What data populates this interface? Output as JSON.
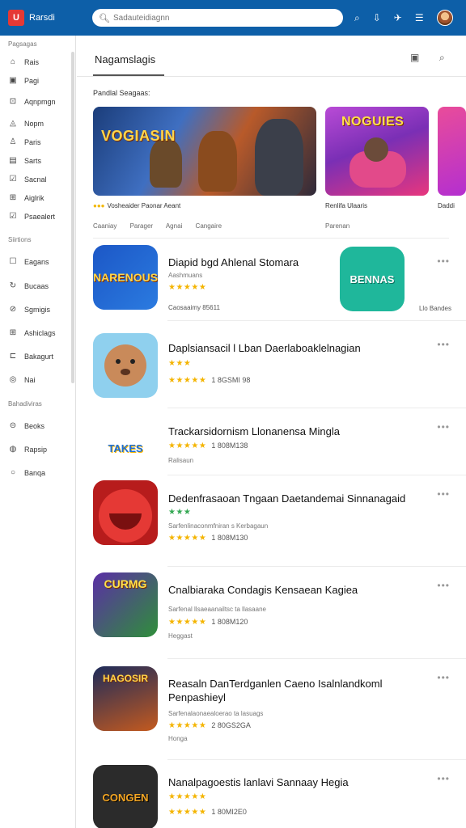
{
  "topbar": {
    "logo_glyph": "U",
    "brand": "Rarsdi",
    "search_placeholder": "Sadauteidiagnn",
    "icons": [
      "search-icon",
      "download-icon",
      "plane-icon",
      "menu-icon",
      "avatar"
    ]
  },
  "sidebar": {
    "section1": "Pagsagas",
    "items1": [
      {
        "icon": "⌂",
        "label": "Rais"
      },
      {
        "icon": "▣",
        "label": "Pagi"
      },
      {
        "icon": "⊡",
        "label": "Aqnpmgn"
      },
      {
        "icon": "◬",
        "label": "Nopm"
      },
      {
        "icon": "♙",
        "label": "Paris"
      },
      {
        "icon": "▤",
        "label": "Sarts"
      },
      {
        "icon": "☑",
        "label": "Sacnal"
      },
      {
        "icon": "⊞",
        "label": "Aiglrik"
      },
      {
        "icon": "☑",
        "label": "Psaealert"
      }
    ],
    "section2": "Siirtions",
    "items2": [
      {
        "icon": "☐",
        "label": "Eagans"
      },
      {
        "icon": "↻",
        "label": "Bucaas"
      },
      {
        "icon": "⊘",
        "label": "Sgmigis"
      },
      {
        "icon": "⊞",
        "label": "Ashiclags"
      },
      {
        "icon": "⊏",
        "label": "Bakagurt"
      },
      {
        "icon": "◎",
        "label": "Nai"
      }
    ],
    "section3": "Bahadiviras",
    "items3": [
      {
        "icon": "⊝",
        "label": "Beoks"
      },
      {
        "icon": "◍",
        "label": "Rapsip"
      },
      {
        "icon": "○",
        "label": "Banqa"
      }
    ]
  },
  "header": {
    "title": "Nagamslagis",
    "subheading": "Pandlal Seagaas:",
    "icon_left": "calendar-icon",
    "icon_right": "search-icon"
  },
  "banners": [
    {
      "text": "VOGIASIN",
      "caption": "Vosheaider Paonar Aeant",
      "caption_dots": "●●●"
    },
    {
      "text": "NOGUIES",
      "caption": "Renlifa Ulaaris",
      "caption_dots": ""
    },
    {
      "text": "",
      "caption": "Daddi",
      "caption_dots": ""
    }
  ],
  "tags": [
    "Caaniay",
    "Parager",
    "Agnai",
    "Cangaire"
  ],
  "tag_right": "Parenan",
  "apps": [
    {
      "icon_text": "NARENOUS",
      "name": "Diapid bgd Ahlenal Stomara",
      "sub": "Aashmuans",
      "stars": "★★★★★",
      "meta": "Caosaaimy   85611",
      "side_icon_text": "BENNAS",
      "side_label": "Llo Bandes"
    },
    {
      "icon_text": "",
      "name": "Daplsiansacil l Lban Daerlaboaklelnagian",
      "stars_short": "★★★",
      "rating": "★★★★★",
      "rating_count": "1 8GSMI 98"
    },
    {
      "icon_text": "TAKES",
      "name": "Trackarsidornism Llonanensa Mingla",
      "rating": "★★★★★",
      "rating_count": "1 808M138",
      "sub": "Ralisaun"
    },
    {
      "icon_text": "",
      "name": "Dedenfrasaoan Tngaan Daetandemai Sinnanagaid",
      "stars_short": "★★★",
      "sub": "Sarfenlinaconmfniran s Kerbagaun",
      "rating": "★★★★★",
      "rating_count": "1 808M130"
    },
    {
      "icon_text": "CURMG",
      "name": "Cnalbiaraka Condagis Kensaean Kagiea",
      "sub": "Sarfenal llsaeaanailtsc ta llasaane",
      "rating": "★★★★★",
      "rating_count": "1 808M120",
      "sub2": "Heggast"
    },
    {
      "icon_text": "HAGOSIR",
      "name": "Reasaln DanTerdganlen Caeno Isalnlandkoml Penpashieyl",
      "sub": "Sarfenalaonaealoerao ta lasuags",
      "rating": "★★★★★",
      "rating_count": "2 80GS2GA",
      "sub2": "Honga"
    },
    {
      "icon_text": "CONGEN",
      "name": "Nanalpagoestis lanlavi Sannaay Hegia",
      "stars_short": "★★★★★",
      "rating": "★★★★★",
      "rating_count": "1 80MI2E0"
    }
  ],
  "more_glyph": "•••"
}
